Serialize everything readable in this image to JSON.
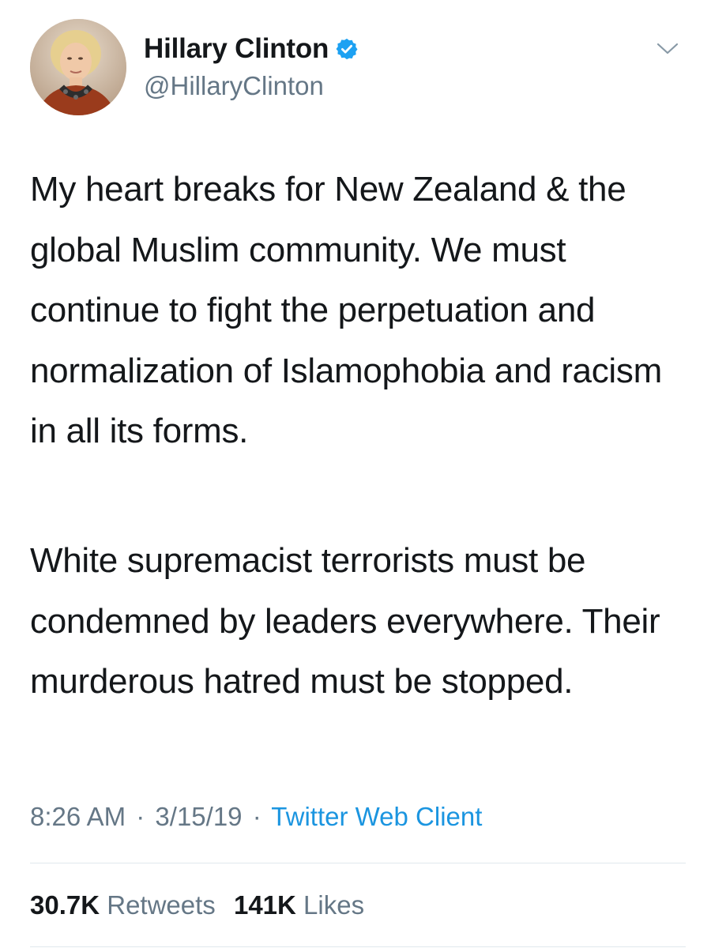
{
  "author": {
    "display_name": "Hillary Clinton",
    "handle": "@HillaryClinton",
    "verified": true,
    "avatar_icon": "profile-photo"
  },
  "tweet": {
    "paragraphs": [
      "My heart breaks for New Zealand & the global Muslim community. We must continue to fight the perpetuation and normalization of Islamophobia and racism in all its forms.",
      "White supremacist terrorists must be condemned by leaders everywhere. Their murderous hatred must be stopped."
    ]
  },
  "meta": {
    "time": "8:26 AM",
    "separator": "·",
    "date": "3/15/19",
    "source": "Twitter Web Client"
  },
  "stats": {
    "retweets_count": "30.7K",
    "retweets_label": "Retweets",
    "likes_count": "141K",
    "likes_label": "Likes"
  },
  "colors": {
    "text_primary": "#14171a",
    "text_secondary": "#657786",
    "link_blue": "#1b95e0",
    "verified_blue": "#1da1f2",
    "divider": "#e1e8ed"
  },
  "icons": {
    "verified": "verified-badge-icon",
    "menu": "chevron-down-icon"
  }
}
